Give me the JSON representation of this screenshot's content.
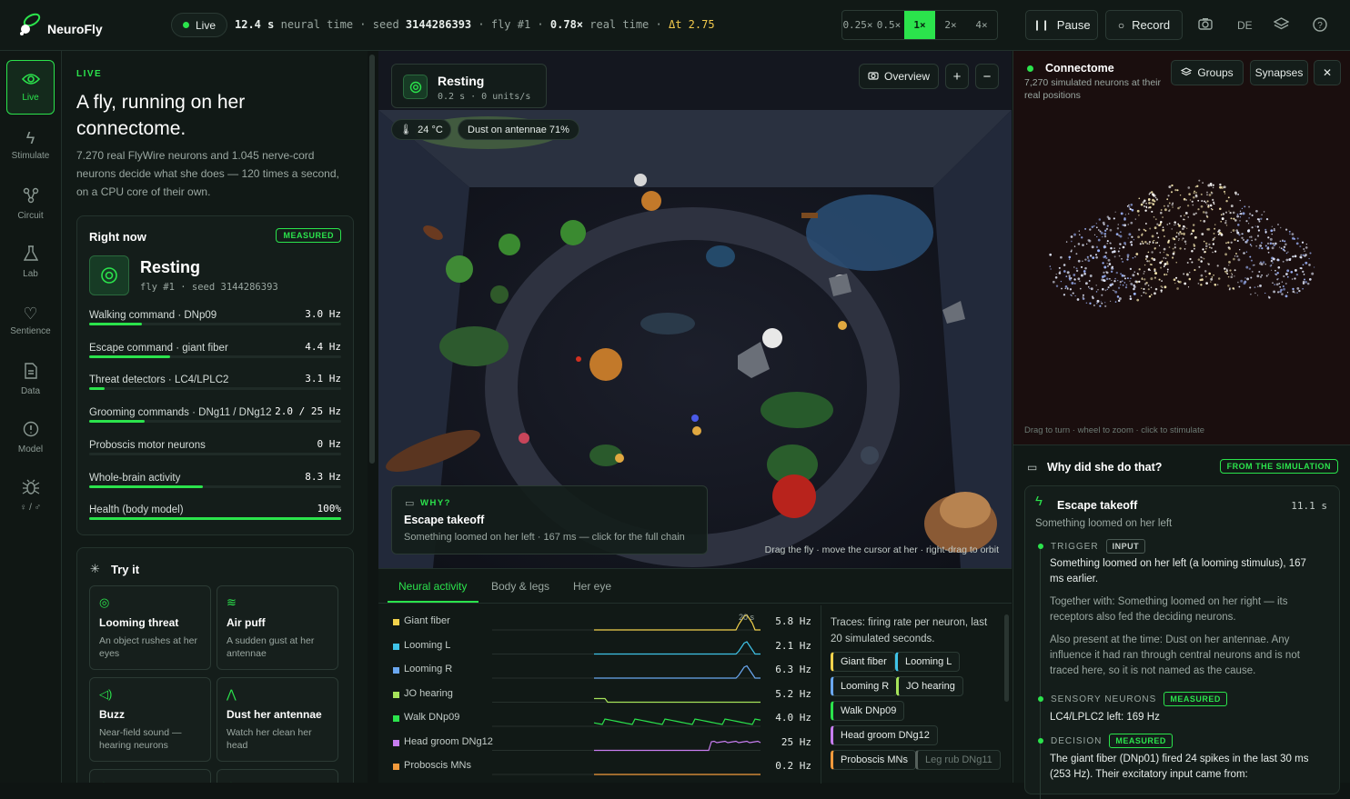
{
  "app": {
    "name": "NeuroFly"
  },
  "topbar": {
    "live": "Live",
    "neural_time": "12.4 s",
    "neural_time_label": "neural time",
    "seed_label": "seed",
    "seed": "3144286393",
    "fly": "fly #1",
    "real_ratio": "0.78×",
    "real_label": "real time",
    "dt": "Δt 2.75",
    "speeds": [
      "0.25×",
      "0.5×",
      "1×",
      "2×",
      "4×"
    ],
    "speed_selected": "1×",
    "pause": "Pause",
    "record": "Record",
    "lang": "DE"
  },
  "rail": [
    {
      "label": "Live",
      "icon": "eye-icon"
    },
    {
      "label": "Stimulate",
      "icon": "bolt-icon"
    },
    {
      "label": "Circuit",
      "icon": "circuit-icon"
    },
    {
      "label": "Lab",
      "icon": "flask-icon"
    },
    {
      "label": "Sentience",
      "icon": "heart-icon"
    },
    {
      "label": "Data",
      "icon": "document-icon"
    },
    {
      "label": "Model",
      "icon": "info-icon"
    },
    {
      "label": "♀ / ♂",
      "icon": "bug-icon"
    }
  ],
  "left": {
    "eyebrow": "LIVE",
    "headline": "A fly, running on her connectome.",
    "sub": "7.270 real FlyWire neurons and 1.045 nerve-cord neurons decide what she does — 120 times a second, on a CPU core of their own.",
    "right_now": {
      "title": "Right now",
      "badge": "MEASURED",
      "state": "Resting",
      "state_sub": "fly #1 · seed 3144286393",
      "metrics": [
        {
          "label": "Walking command · DNp09",
          "value": "3.0 Hz",
          "fill": 0.21
        },
        {
          "label": "Escape command · giant fiber",
          "value": "4.4 Hz",
          "fill": 0.32
        },
        {
          "label": "Threat detectors · LC4/LPLC2",
          "value": "3.1 Hz",
          "fill": 0.06
        },
        {
          "label": "Grooming commands · DNg11 / DNg12",
          "value": "2.0 / 25 Hz",
          "fill": 0.22
        },
        {
          "label": "Proboscis motor neurons",
          "value": "0 Hz",
          "fill": 0
        },
        {
          "label": "Whole-brain activity",
          "value": "8.3 Hz",
          "fill": 0.45
        },
        {
          "label": "Health (body model)",
          "value": "100%",
          "fill": 1.0
        }
      ]
    },
    "try_it": {
      "title": "Try it",
      "items": [
        {
          "title": "Looming threat",
          "desc": "An object rushes at her eyes",
          "icon": "target-icon"
        },
        {
          "title": "Air puff",
          "desc": "A sudden gust at her antennae",
          "icon": "wind-icon"
        },
        {
          "title": "Buzz",
          "desc": "Near-field sound — hearing neurons",
          "icon": "speaker-icon"
        },
        {
          "title": "Dust her antennae",
          "desc": "Watch her clean her head",
          "icon": "antenna-icon"
        }
      ]
    }
  },
  "scene": {
    "state": "Resting",
    "state_sub": "0.2 s · 0 units/s",
    "temp": "24 °C",
    "dust": "Dust on antennae 71%",
    "overview": "Overview",
    "why_label": "WHY?",
    "why_title": "Escape takeoff",
    "why_desc": "Something loomed on her left · 167 ms — click for the full chain",
    "hint": "Drag the fly · move the cursor at her · right-drag to orbit"
  },
  "bottom": {
    "tabs": [
      "Neural activity",
      "Body & legs",
      "Her eye"
    ],
    "marker": "20 s",
    "traces": [
      {
        "label": "Giant fiber",
        "value": "5.8 Hz",
        "color": "#f2d24c"
      },
      {
        "label": "Looming L",
        "value": "2.1 Hz",
        "color": "#3fc3e8"
      },
      {
        "label": "Looming R",
        "value": "6.3 Hz",
        "color": "#6aa7f0"
      },
      {
        "label": "JO hearing",
        "value": "5.2 Hz",
        "color": "#a6e35a"
      },
      {
        "label": "Walk DNp09",
        "value": "4.0 Hz",
        "color": "#2be34c"
      },
      {
        "label": "Head groom DNg12",
        "value": "25 Hz",
        "color": "#c77df0"
      },
      {
        "label": "Proboscis MNs",
        "value": "0.2 Hz",
        "color": "#f29a3c"
      }
    ],
    "legend_note": "Traces: firing rate per neuron, last 20 simulated seconds.",
    "chips": [
      {
        "label": "Giant fiber",
        "color": "#f2d24c"
      },
      {
        "label": "Looming L",
        "color": "#3fc3e8"
      },
      {
        "label": "Looming R",
        "color": "#6aa7f0"
      },
      {
        "label": "JO hearing",
        "color": "#a6e35a"
      },
      {
        "label": "Walk DNp09",
        "color": "#2be34c"
      },
      {
        "label": "Head groom DNg12",
        "color": "#c77df0"
      },
      {
        "label": "Proboscis MNs",
        "color": "#f29a3c"
      },
      {
        "label": "Leg rub DNg11",
        "color": "#55605b"
      }
    ]
  },
  "right": {
    "title": "Connectome",
    "sub": "7,270 simulated neurons at their real positions",
    "groups": "Groups",
    "synapses": "Synapses",
    "hint": "Drag to turn · wheel to zoom · click to stimulate",
    "why": {
      "title": "Why did she do that?",
      "badge": "FROM THE SIMULATION",
      "event": "Escape takeoff",
      "event_time": "11.1 s",
      "event_sub": "Something loomed on her left",
      "trigger_label": "TRIGGER",
      "trigger_badge": "INPUT",
      "trigger_text": "Something loomed on her left (a looming stimulus), 167 ms earlier.",
      "together": "Together with: Something loomed on her right — its receptors also fed the deciding neurons.",
      "also": "Also present at the time: Dust on her antennae. Any influence it had ran through central neurons and is not traced here, so it is not named as the cause.",
      "sensory_label": "SENSORY NEURONS",
      "sensory_badge": "MEASURED",
      "sensory_text": "LC4/LPLC2 left: 169 Hz",
      "decision_label": "DECISION",
      "decision_badge": "MEASURED",
      "decision_text": "The giant fiber (DNp01) fired 24 spikes in the last 30 ms (253 Hz). Their excitatory input came from:"
    }
  }
}
